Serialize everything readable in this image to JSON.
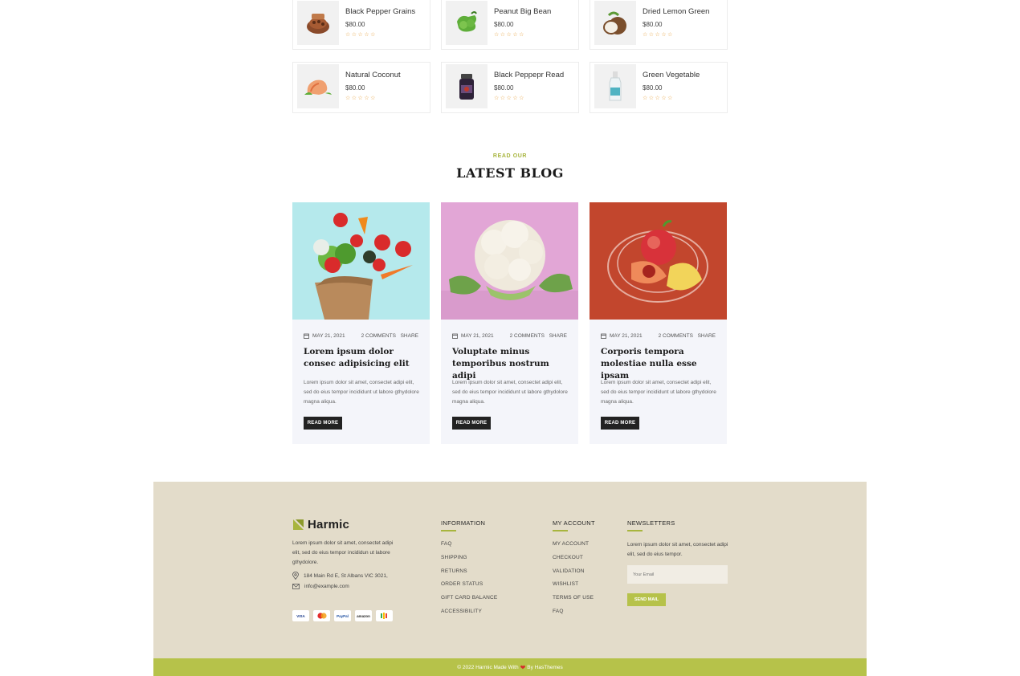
{
  "products": [
    {
      "name": "Black Pepper Grains",
      "price": "$80.00",
      "stars": "☆☆☆☆☆"
    },
    {
      "name": "Peanut Big Bean",
      "price": "$80.00",
      "stars": "☆☆☆☆☆"
    },
    {
      "name": "Dried Lemon Green",
      "price": "$80.00",
      "stars": "☆☆☆☆☆"
    },
    {
      "name": "Natural Coconut",
      "price": "$80.00",
      "stars": "☆☆☆☆☆"
    },
    {
      "name": "Black Peppepr Read",
      "price": "$80.00",
      "stars": "☆☆☆☆☆"
    },
    {
      "name": "Green Vegetable",
      "price": "$80.00",
      "stars": "☆☆☆☆☆"
    }
  ],
  "blog": {
    "eyebrow": "READ OUR",
    "title": "LATEST BLOG",
    "posts": [
      {
        "date": "MAY 21, 2021",
        "comments": "2 COMMENTS",
        "share": "SHARE",
        "title": "Lorem ipsum dolor consec adipisicing elit",
        "excerpt": "Lorem ipsum dolor sit amet, consectet adipi elit, sed do eius tempor incididunt ut labore gthydolore magna aliqua.",
        "button": "READ MORE"
      },
      {
        "date": "MAY 21, 2021",
        "comments": "2 COMMENTS",
        "share": "SHARE",
        "title": "Voluptate minus temporibus nostrum adipi",
        "excerpt": "Lorem ipsum dolor sit amet, consectet adipi elit, sed do eius tempor incididunt ut labore gthydolore magna aliqua.",
        "button": "READ MORE"
      },
      {
        "date": "MAY 21, 2021",
        "comments": "2 COMMENTS",
        "share": "SHARE",
        "title": "Corporis tempora molestiae nulla esse ipsam",
        "excerpt": "Lorem ipsum dolor sit amet, consectet adipi elit, sed do eius tempor incididunt ut labore gthydolore magna aliqua.",
        "button": "READ MORE"
      }
    ]
  },
  "footer": {
    "brand": "Harmic",
    "about": "Lorem ipsum dolor sit amet, consectet adipi elit, sed do eius tempor incididun ut labore gthydolore.",
    "address": "184 Main Rd E, St Albans VIC 3021,",
    "email": "info@example.com",
    "payments": [
      "VISA",
      "MC",
      "PayPal",
      "amazon",
      "G"
    ],
    "information": {
      "title": "INFORMATION",
      "links": [
        "FAQ",
        "SHIPPING",
        "RETURNS",
        "ORDER STATUS",
        "GIFT CARD BALANCE",
        "ACCESSIBILITY"
      ]
    },
    "account": {
      "title": "MY ACCOUNT",
      "links": [
        "MY ACCOUNT",
        "CHECKOUT",
        "VALIDATION",
        "WISHLIST",
        "TERMS OF USE",
        "FAQ"
      ]
    },
    "newsletter": {
      "title": "NEWSLETTERS",
      "text": "Lorem ipsum dolor sit amet, consectet adipi elit, sed do eius tempor.",
      "placeholder": "Your Email",
      "button": "SEND MAIL"
    },
    "copyright_left": "© 2022 Harmic Made With",
    "copyright_right": "By HasThemes"
  },
  "colors": {
    "accent": "#b6c24a",
    "footer_bg": "#e3dcca",
    "star": "#e6a03c"
  }
}
